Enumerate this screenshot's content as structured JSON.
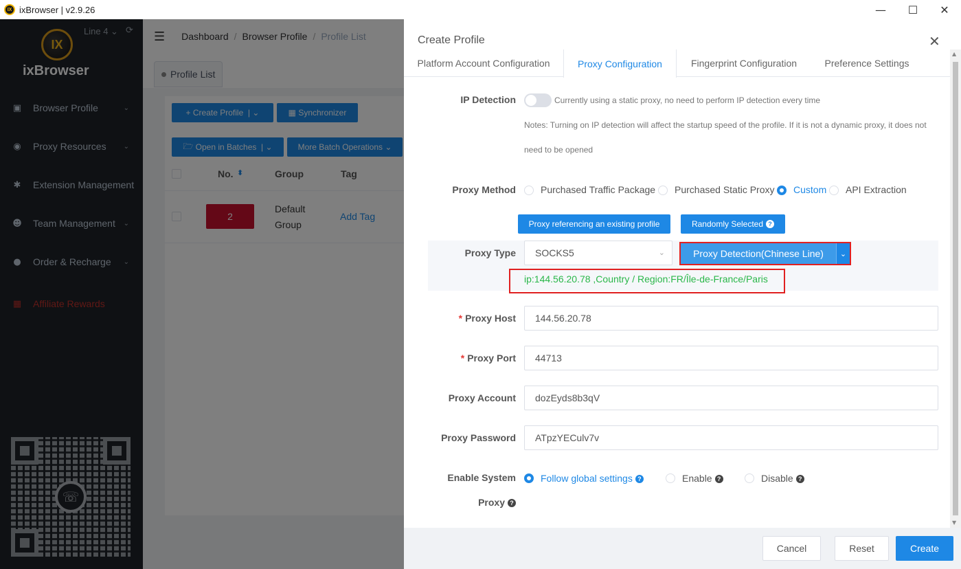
{
  "window": {
    "title": "ixBrowser | v2.9.26",
    "logo_text": "IX",
    "controls": [
      "minimize-icon",
      "maximize-icon",
      "close-icon"
    ]
  },
  "sidebar": {
    "brand": "ixBrowser",
    "brand_logo_text": "IX",
    "line_label": "Line 4",
    "items": [
      {
        "label": "Browser Profile",
        "icon": "browser-icon",
        "expandable": true
      },
      {
        "label": "Proxy Resources",
        "icon": "globe-icon",
        "expandable": true
      },
      {
        "label": "Extension Management",
        "icon": "puzzle-icon",
        "expandable": false
      },
      {
        "label": "Team Management",
        "icon": "user-icon",
        "expandable": true
      },
      {
        "label": "Order & Recharge",
        "icon": "dollar-icon",
        "expandable": true
      },
      {
        "label": "Affiliate Rewards",
        "icon": "gift-icon",
        "expandable": false
      }
    ]
  },
  "header": {
    "breadcrumb": [
      "Dashboard",
      "Browser Profile",
      "Profile List"
    ]
  },
  "tabs": {
    "active_tab": "Profile List"
  },
  "toolbar": {
    "create_profile": "Create Profile",
    "synchronizer": "Synchronizer",
    "open_in_batches": "Open in Batches",
    "more_batch_operations": "More Batch Operations"
  },
  "table": {
    "columns": [
      "No.",
      "Group",
      "Tag"
    ],
    "rows": [
      {
        "no": "2",
        "group": "Default Group",
        "tag": "Add Tag"
      }
    ]
  },
  "drawer": {
    "title": "Create Profile",
    "tabs": [
      "Platform Account Configuration",
      "Proxy Configuration",
      "Fingerprint Configuration",
      "Preference Settings"
    ],
    "active_tab": "Proxy Configuration",
    "ip_detection": {
      "label": "IP Detection",
      "enabled": false,
      "hint": "Currently using a static proxy, no need to perform IP detection every time",
      "notes_line1": "Notes: Turning on IP detection will affect the startup speed of the profile. If it is not a dynamic proxy, it does not",
      "notes_line2": "need to be opened"
    },
    "proxy_method": {
      "label": "Proxy Method",
      "options": [
        "Purchased Traffic Package",
        "Purchased Static Proxy",
        "Custom",
        "API Extraction"
      ],
      "selected": "Custom"
    },
    "buttons": {
      "reference_profile": "Proxy referencing an existing profile",
      "random": "Randomly Selected"
    },
    "proxy_type": {
      "label": "Proxy Type",
      "value": "SOCKS5",
      "detect_button": "Proxy Detection(Chinese Line)"
    },
    "detection_result": "ip:144.56.20.78 ,Country / Region:FR/Île-de-France/Paris",
    "proxy_host": {
      "label": "Proxy Host",
      "value": "144.56.20.78"
    },
    "proxy_port": {
      "label": "Proxy Port",
      "value": "44713"
    },
    "proxy_account": {
      "label": "Proxy Account",
      "value": "dozEyds8b3qV"
    },
    "proxy_password": {
      "label": "Proxy Password",
      "value": "ATpzYECulv7v"
    },
    "system_proxy": {
      "label_line1": "Enable System",
      "label_line2": "Proxy",
      "options": [
        "Follow global settings",
        "Enable",
        "Disable"
      ],
      "selected": "Follow global settings"
    },
    "footer": {
      "cancel": "Cancel",
      "reset": "Reset",
      "create": "Create"
    }
  },
  "colors": {
    "accent": "#1e88e5",
    "success_text": "#2ab749",
    "highlight_border": "#e02020",
    "sidebar_bg": "#1f2329",
    "affiliate": "#c0302b",
    "badge_red": "#c8102e"
  }
}
